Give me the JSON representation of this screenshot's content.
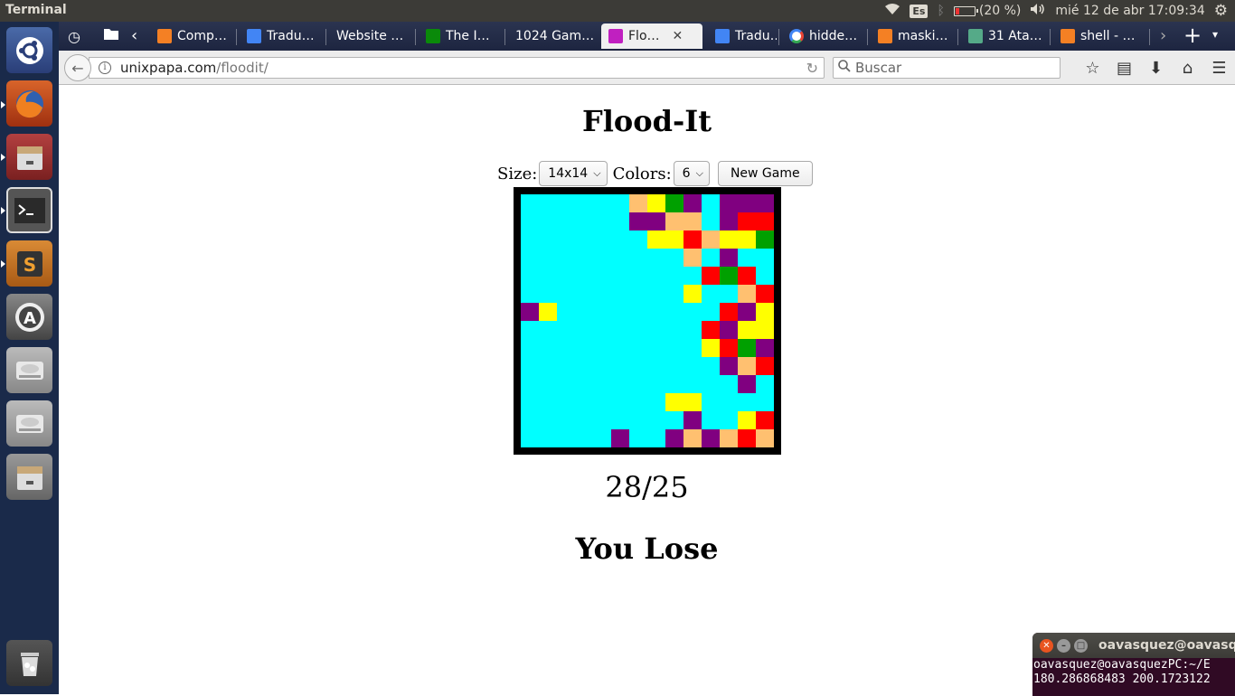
{
  "top_panel": {
    "app_title": "Terminal",
    "keyboard_layout": "Es",
    "battery_text": "(20 %)",
    "battery_level": 0.2,
    "datetime": "mié 12 de abr 17:09:34"
  },
  "launcher": {
    "items": [
      {
        "name": "ubuntu-dash-icon",
        "color": "#dd4814"
      },
      {
        "name": "firefox-icon",
        "color": "#e66000"
      },
      {
        "name": "files-icon",
        "color": "#a33"
      },
      {
        "name": "terminal-app-icon",
        "color": "#333"
      },
      {
        "name": "sublime-text-icon",
        "color": "#d9822b"
      },
      {
        "name": "software-updater-icon",
        "color": "#555"
      },
      {
        "name": "drive-icon",
        "color": "#999"
      },
      {
        "name": "drive-icon-2",
        "color": "#999"
      },
      {
        "name": "files-icon-2",
        "color": "#a33"
      },
      {
        "name": "trash-icon",
        "color": "#ccc"
      }
    ]
  },
  "browser": {
    "tabs": [
      {
        "label": "Comp…",
        "favicon": "stack-overflow-icon",
        "color": "#f48024"
      },
      {
        "label": "Tradu…",
        "favicon": "google-translate-icon",
        "color": "#4285f4"
      },
      {
        "label": "Website …",
        "favicon": "",
        "color": ""
      },
      {
        "label": "The I…",
        "favicon": "green-square-icon",
        "color": "#0a8a0a"
      },
      {
        "label": "1024 Gam…",
        "favicon": "",
        "color": ""
      },
      {
        "label": "Flo…",
        "favicon": "floodit-icon",
        "color": "#c020c0",
        "active": true
      },
      {
        "label": "Tradu…",
        "favicon": "google-translate-icon",
        "color": "#4285f4"
      },
      {
        "label": "hidde…",
        "favicon": "google-icon",
        "color": "#fff"
      },
      {
        "label": "maski…",
        "favicon": "stack-overflow-icon",
        "color": "#f48024"
      },
      {
        "label": "31 Ata…",
        "favicon": "globe-icon",
        "color": "#5a8"
      },
      {
        "label": "shell - …",
        "favicon": "stack-overflow-icon",
        "color": "#f48024"
      }
    ],
    "url_host": "unixpapa.com",
    "url_path": "/floodit/",
    "search_placeholder": "Buscar"
  },
  "game": {
    "title": "Flood-It",
    "size_label": "Size:",
    "size_value": "14x14",
    "colors_label": "Colors:",
    "colors_value": "6",
    "new_game_label": "New Game",
    "score": "28/25",
    "status": "You Lose",
    "palette": {
      "C": "#00ffff",
      "P": "#800080",
      "Y": "#ffff00",
      "G": "#00a000",
      "R": "#ff0000",
      "O": "#ffc070"
    },
    "board": [
      "CCCCCCOYGPCPPP",
      "CCCCCCPPOOCPRR",
      "CCCCCCCYYROYYG",
      "CCCCCCCCCOCPCC",
      "CCCCCCCCCCRGR",
      "CCCCCCCCCYCCOR",
      "PYCCCCCCCCCRPY",
      "CCCCCCCCCCRPYY",
      "CCCCCCCCCCYRGP",
      "CCCCCCCCCCCPOR",
      "CCCCCCCCCCCCPC",
      "CCCCCCCCYYCCCC",
      "CCCCCCCCCPCCYR",
      "CCCCCPCCPOPORO"
    ]
  },
  "terminal": {
    "title": "oavasquez@oavasquez",
    "lines": [
      "oavasquez@oavasquezPC:~/E",
      "180.286868483 200.1723122"
    ]
  }
}
